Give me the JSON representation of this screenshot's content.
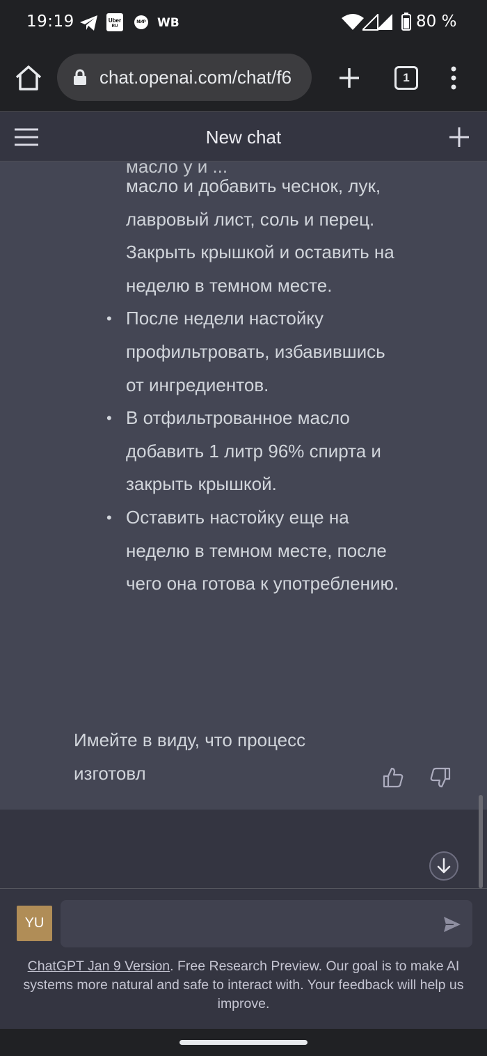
{
  "status_bar": {
    "time": "19:19",
    "uber_label": "Uber",
    "uber_sub": "RU",
    "mir_label": "МИР",
    "wb_label": "WB",
    "battery": "80 %"
  },
  "browser": {
    "url": "chat.openai.com/chat/f6",
    "tab_count": "1"
  },
  "chat": {
    "title": "New chat",
    "partial_top_line": "масло у и ...",
    "steps": [
      "масло и добавить чеснок, лук, лавровый лист, соль и перец. Закрыть крышкой и оставить на неделю в темном месте.",
      "После недели настойку профильтровать, избавившись от ингредиентов.",
      "В отфильтрованное масло добавить 1 литр 96% спирта и закрыть крышкой.",
      "Оставить настойку еще на неделю в темном месте, после чего она готова к употреблению."
    ],
    "closing": "Имейте в виду, что процесс изготовл"
  },
  "input": {
    "avatar_initials": "YU",
    "placeholder": ""
  },
  "footer": {
    "version_link": "ChatGPT Jan 9 Version",
    "text": ". Free Research Preview. Our goal is to make AI systems more natural and safe to interact with. Your feedback will help us improve."
  },
  "colors": {
    "page_bg": "#343541",
    "assistant_bg": "#444654",
    "browser_bg": "#202124",
    "avatar_bg": "#b08d57"
  },
  "icons": [
    "home-icon",
    "lock-icon",
    "plus-icon",
    "tabs-icon",
    "overflow-menu-icon",
    "hamburger-icon",
    "thumbs-up-icon",
    "thumbs-down-icon",
    "arrow-down-icon",
    "send-icon",
    "telegram-icon",
    "wifi-icon",
    "signal-icon",
    "battery-icon"
  ]
}
